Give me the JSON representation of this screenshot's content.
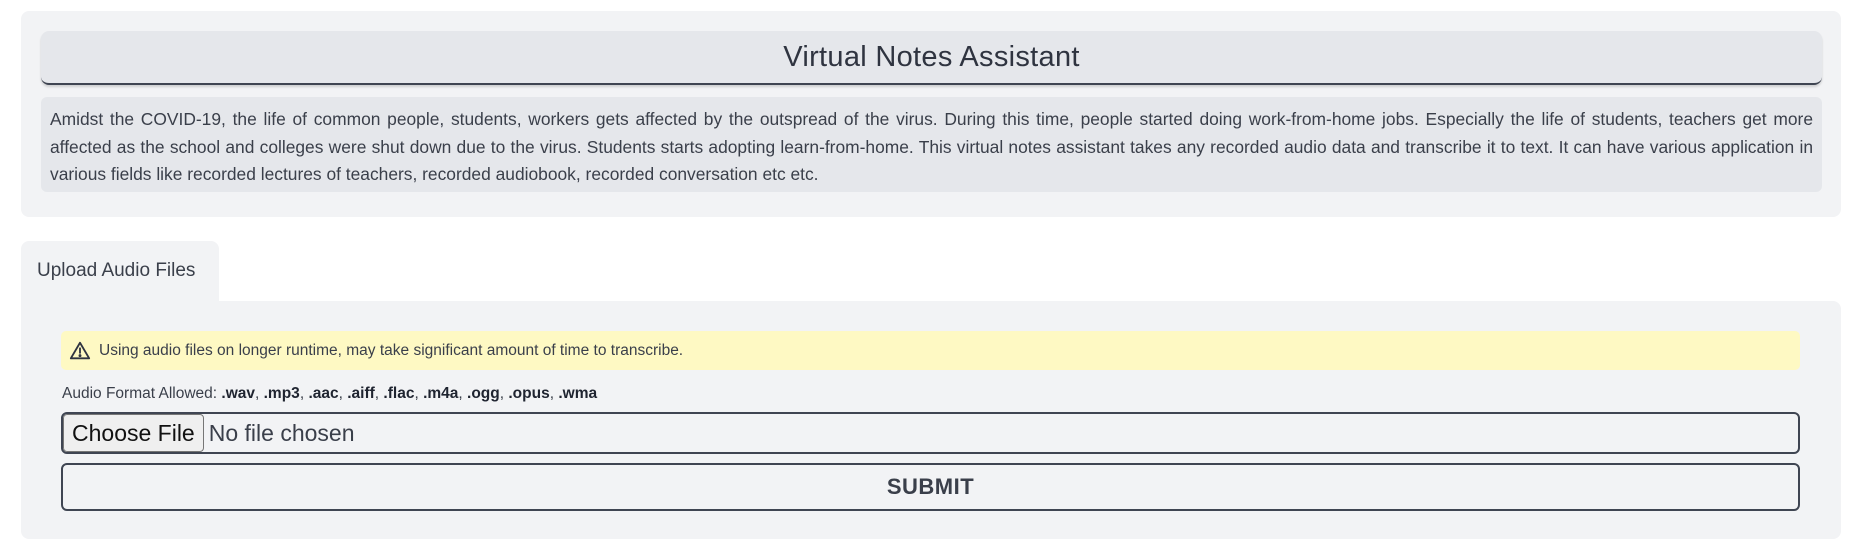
{
  "header": {
    "title": "Virtual Notes Assistant",
    "description": "Amidst the COVID-19, the life of common people, students, workers gets affected by the outspread of the virus. During this time, people started doing work-from-home jobs. Especially the life of students, teachers get more affected as the school and colleges were shut down due to the virus. Students starts adopting learn-from-home. This virtual notes assistant takes any recorded audio data and transcribe it to text. It can have various application in various fields like recorded lectures of teachers, recorded audiobook, recorded conversation etc etc."
  },
  "tabs": [
    {
      "label": "Upload Audio Files",
      "active": true
    }
  ],
  "upload": {
    "warning_icon": "warning-triangle-icon",
    "warning_text": "Using audio files on longer runtime, may take significant amount of time to transcribe.",
    "formats_label": "Audio Format Allowed: ",
    "formats": [
      ".wav",
      ".mp3",
      ".aac",
      ".aiff",
      ".flac",
      ".m4a",
      ".ogg",
      ".opus",
      ".wma"
    ],
    "choose_file_label": "Choose File",
    "file_status": "No file chosen",
    "submit_label": "SUBMIT"
  },
  "colors": {
    "card_bg": "#f2f3f5",
    "title_bg": "#e5e7eb",
    "warning_bg": "#fef9c3",
    "border": "#3f4552"
  }
}
